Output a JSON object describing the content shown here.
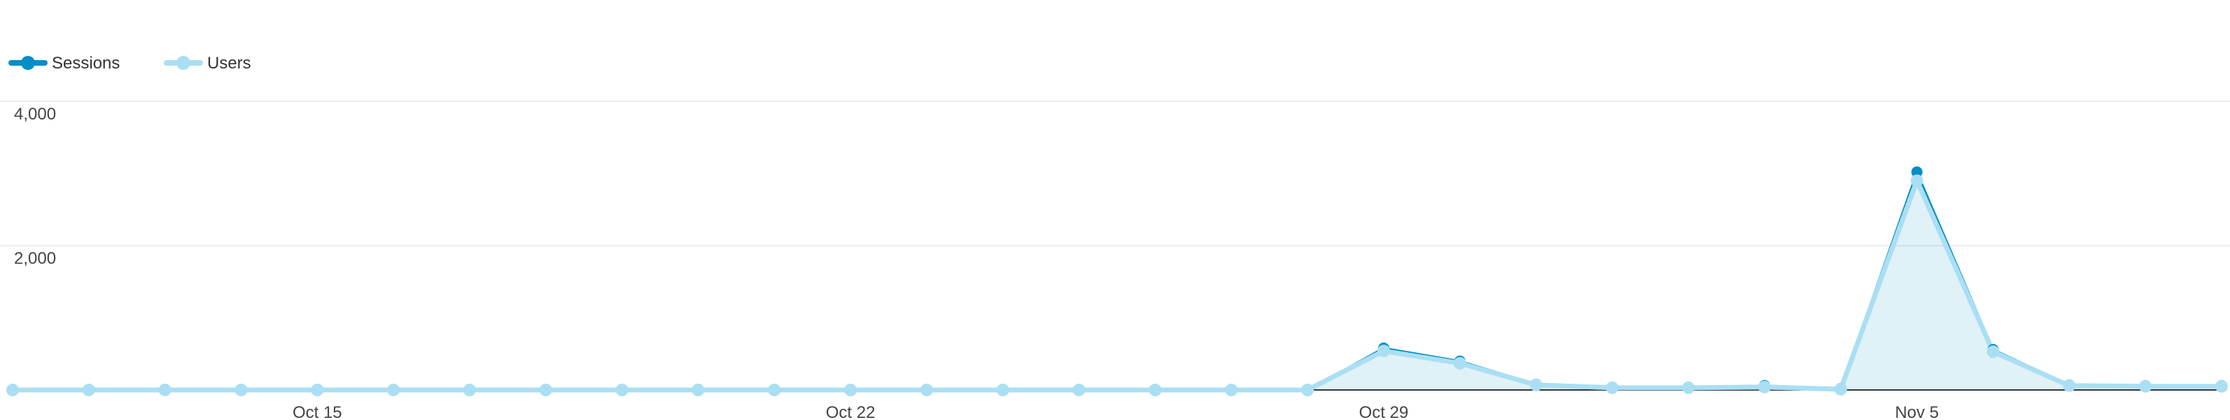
{
  "chart_data": {
    "type": "line",
    "x_tick_labels": [
      "Oct 15",
      "Oct 22",
      "Oct 29",
      "Nov 5"
    ],
    "x_tick_index": [
      4,
      11,
      18,
      25
    ],
    "y_ticks": [
      2000,
      4000
    ],
    "y_tick_labels": [
      "2,000",
      "4,000"
    ],
    "ylim": [
      0,
      4000
    ],
    "grid": true,
    "legend": "top-left",
    "series": [
      {
        "name": "Sessions",
        "color": "#058dc7",
        "values": [
          0,
          0,
          0,
          0,
          0,
          0,
          0,
          0,
          0,
          0,
          0,
          0,
          0,
          0,
          0,
          0,
          0,
          0,
          580,
          400,
          80,
          40,
          40,
          60,
          20,
          3020,
          560,
          70,
          60,
          60
        ]
      },
      {
        "name": "Users",
        "color": "#aadff3",
        "values": [
          0,
          0,
          0,
          0,
          0,
          0,
          0,
          0,
          0,
          0,
          0,
          0,
          0,
          0,
          0,
          0,
          0,
          0,
          540,
          370,
          70,
          30,
          30,
          40,
          10,
          2900,
          530,
          60,
          50,
          50
        ]
      }
    ]
  }
}
